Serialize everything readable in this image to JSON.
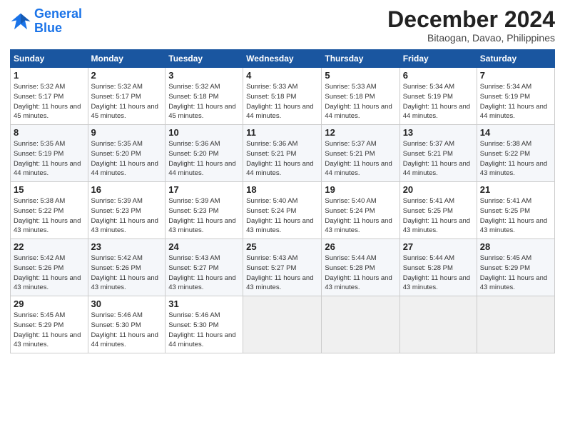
{
  "logo": {
    "line1": "General",
    "line2": "Blue"
  },
  "title": "December 2024",
  "subtitle": "Bitaogan, Davao, Philippines",
  "days_of_week": [
    "Sunday",
    "Monday",
    "Tuesday",
    "Wednesday",
    "Thursday",
    "Friday",
    "Saturday"
  ],
  "weeks": [
    [
      {
        "num": "1",
        "sunrise": "5:32 AM",
        "sunset": "5:17 PM",
        "daylight": "11 hours and 45 minutes."
      },
      {
        "num": "2",
        "sunrise": "5:32 AM",
        "sunset": "5:17 PM",
        "daylight": "11 hours and 45 minutes."
      },
      {
        "num": "3",
        "sunrise": "5:32 AM",
        "sunset": "5:18 PM",
        "daylight": "11 hours and 45 minutes."
      },
      {
        "num": "4",
        "sunrise": "5:33 AM",
        "sunset": "5:18 PM",
        "daylight": "11 hours and 44 minutes."
      },
      {
        "num": "5",
        "sunrise": "5:33 AM",
        "sunset": "5:18 PM",
        "daylight": "11 hours and 44 minutes."
      },
      {
        "num": "6",
        "sunrise": "5:34 AM",
        "sunset": "5:19 PM",
        "daylight": "11 hours and 44 minutes."
      },
      {
        "num": "7",
        "sunrise": "5:34 AM",
        "sunset": "5:19 PM",
        "daylight": "11 hours and 44 minutes."
      }
    ],
    [
      {
        "num": "8",
        "sunrise": "5:35 AM",
        "sunset": "5:19 PM",
        "daylight": "11 hours and 44 minutes."
      },
      {
        "num": "9",
        "sunrise": "5:35 AM",
        "sunset": "5:20 PM",
        "daylight": "11 hours and 44 minutes."
      },
      {
        "num": "10",
        "sunrise": "5:36 AM",
        "sunset": "5:20 PM",
        "daylight": "11 hours and 44 minutes."
      },
      {
        "num": "11",
        "sunrise": "5:36 AM",
        "sunset": "5:21 PM",
        "daylight": "11 hours and 44 minutes."
      },
      {
        "num": "12",
        "sunrise": "5:37 AM",
        "sunset": "5:21 PM",
        "daylight": "11 hours and 44 minutes."
      },
      {
        "num": "13",
        "sunrise": "5:37 AM",
        "sunset": "5:21 PM",
        "daylight": "11 hours and 44 minutes."
      },
      {
        "num": "14",
        "sunrise": "5:38 AM",
        "sunset": "5:22 PM",
        "daylight": "11 hours and 43 minutes."
      }
    ],
    [
      {
        "num": "15",
        "sunrise": "5:38 AM",
        "sunset": "5:22 PM",
        "daylight": "11 hours and 43 minutes."
      },
      {
        "num": "16",
        "sunrise": "5:39 AM",
        "sunset": "5:23 PM",
        "daylight": "11 hours and 43 minutes."
      },
      {
        "num": "17",
        "sunrise": "5:39 AM",
        "sunset": "5:23 PM",
        "daylight": "11 hours and 43 minutes."
      },
      {
        "num": "18",
        "sunrise": "5:40 AM",
        "sunset": "5:24 PM",
        "daylight": "11 hours and 43 minutes."
      },
      {
        "num": "19",
        "sunrise": "5:40 AM",
        "sunset": "5:24 PM",
        "daylight": "11 hours and 43 minutes."
      },
      {
        "num": "20",
        "sunrise": "5:41 AM",
        "sunset": "5:25 PM",
        "daylight": "11 hours and 43 minutes."
      },
      {
        "num": "21",
        "sunrise": "5:41 AM",
        "sunset": "5:25 PM",
        "daylight": "11 hours and 43 minutes."
      }
    ],
    [
      {
        "num": "22",
        "sunrise": "5:42 AM",
        "sunset": "5:26 PM",
        "daylight": "11 hours and 43 minutes."
      },
      {
        "num": "23",
        "sunrise": "5:42 AM",
        "sunset": "5:26 PM",
        "daylight": "11 hours and 43 minutes."
      },
      {
        "num": "24",
        "sunrise": "5:43 AM",
        "sunset": "5:27 PM",
        "daylight": "11 hours and 43 minutes."
      },
      {
        "num": "25",
        "sunrise": "5:43 AM",
        "sunset": "5:27 PM",
        "daylight": "11 hours and 43 minutes."
      },
      {
        "num": "26",
        "sunrise": "5:44 AM",
        "sunset": "5:28 PM",
        "daylight": "11 hours and 43 minutes."
      },
      {
        "num": "27",
        "sunrise": "5:44 AM",
        "sunset": "5:28 PM",
        "daylight": "11 hours and 43 minutes."
      },
      {
        "num": "28",
        "sunrise": "5:45 AM",
        "sunset": "5:29 PM",
        "daylight": "11 hours and 43 minutes."
      }
    ],
    [
      {
        "num": "29",
        "sunrise": "5:45 AM",
        "sunset": "5:29 PM",
        "daylight": "11 hours and 43 minutes."
      },
      {
        "num": "30",
        "sunrise": "5:46 AM",
        "sunset": "5:30 PM",
        "daylight": "11 hours and 44 minutes."
      },
      {
        "num": "31",
        "sunrise": "5:46 AM",
        "sunset": "5:30 PM",
        "daylight": "11 hours and 44 minutes."
      },
      null,
      null,
      null,
      null
    ]
  ]
}
